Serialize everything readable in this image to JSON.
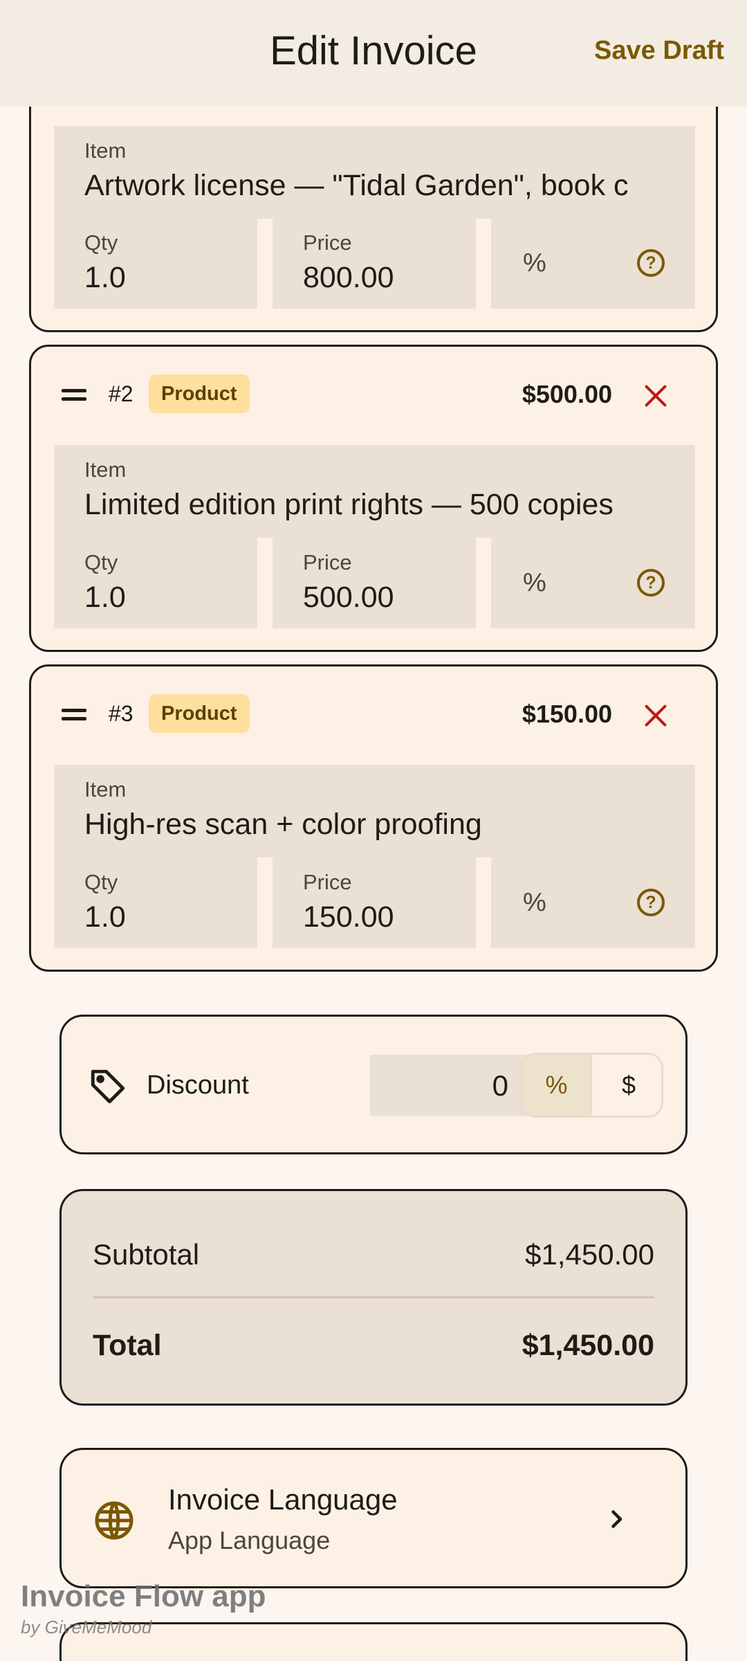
{
  "header": {
    "title": "Edit Invoice",
    "save_label": "Save Draft"
  },
  "field_labels": {
    "item": "Item",
    "qty": "Qty",
    "price": "Price",
    "percent": "%"
  },
  "line_items": [
    {
      "item": "Artwork license — \"Tidal Garden\", book c",
      "qty": "1.0",
      "price": "800.00"
    },
    {
      "number": "#2",
      "type": "Product",
      "amount": "$500.00",
      "item": "Limited edition print rights — 500 copies",
      "qty": "1.0",
      "price": "500.00"
    },
    {
      "number": "#3",
      "type": "Product",
      "amount": "$150.00",
      "item": "High-res scan + color proofing",
      "qty": "1.0",
      "price": "150.00"
    }
  ],
  "discount": {
    "label": "Discount",
    "value": "0",
    "percent_option": "%",
    "dollar_option": "$",
    "selected": "%"
  },
  "totals": {
    "subtotal_label": "Subtotal",
    "subtotal_value": "$1,450.00",
    "total_label": "Total",
    "total_value": "$1,450.00"
  },
  "language": {
    "title": "Invoice Language",
    "value": "App Language"
  },
  "watermark": {
    "title": "Invoice Flow app",
    "byline": "by GiveMeMood"
  },
  "colors": {
    "accent": "#7a5900",
    "badge_bg": "#ffdf9e",
    "delete": "#ba1a1a",
    "field_bg": "#ebe0d4"
  }
}
